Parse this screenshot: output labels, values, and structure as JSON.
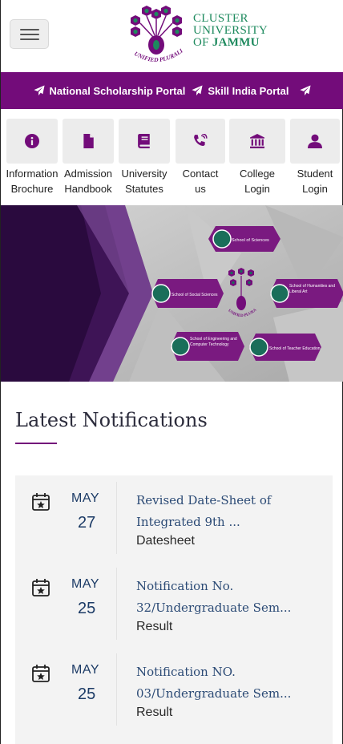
{
  "header": {
    "logo_line1": "CLUSTER",
    "logo_line2": "UNIVERSITY",
    "logo_line3_of": "OF ",
    "logo_line3_name": "JAMMU",
    "logo_motto": "UNIFIED PLURALITY"
  },
  "portals": [
    {
      "label": "National Scholarship Portal"
    },
    {
      "label": "Skill India Portal"
    }
  ],
  "quick_links": [
    {
      "line1": "Information",
      "line2": "Brochure",
      "icon": "info-icon"
    },
    {
      "line1": "Admission",
      "line2": "Handbook",
      "icon": "file-icon"
    },
    {
      "line1": "University",
      "line2": "Statutes",
      "icon": "book-icon"
    },
    {
      "line1": "Contact",
      "line2": "us",
      "icon": "phone-icon"
    },
    {
      "line1": "College",
      "line2": "Login",
      "icon": "building-icon"
    },
    {
      "line1": "Student",
      "line2": "Login",
      "icon": "user-icon"
    }
  ],
  "banner": {
    "schools": [
      "School of Sciences",
      "School of Social Sciences",
      "School of Humanities and Liberal Art",
      "School of Engineering and Computer Technology",
      "School of Teacher Education"
    ],
    "motto": "UNIFIED PLURALITY"
  },
  "notifications": {
    "heading": "Latest Notifications",
    "items": [
      {
        "month": "MAY",
        "day": "27",
        "title_line1": "Revised Date-Sheet of",
        "title_line2": "Integrated 9th ...",
        "category": "Datesheet"
      },
      {
        "month": "MAY",
        "day": "25",
        "title_line1": "Notification No.",
        "title_line2": "32/Undergraduate Sem...",
        "category": "Result"
      },
      {
        "month": "MAY",
        "day": "25",
        "title_line1": "Notification NO.",
        "title_line2": "03/Undergraduate Sem...",
        "category": "Result"
      }
    ]
  },
  "colors": {
    "brand_purple": "#730c7a",
    "brand_green": "#1e8a5e",
    "link_blue": "#2b4a75"
  }
}
